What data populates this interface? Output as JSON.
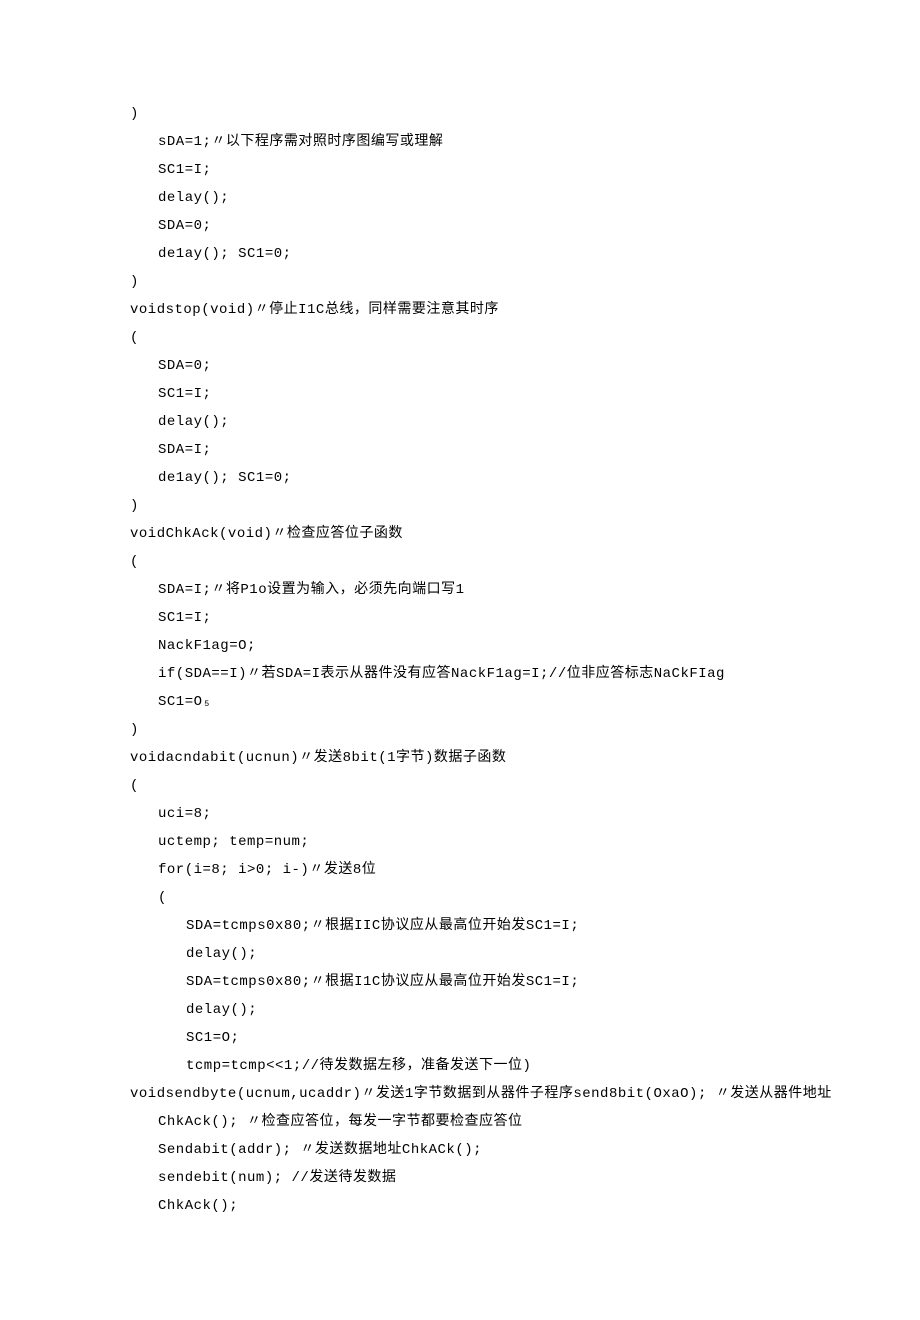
{
  "code_lines": [
    {
      "text": ")",
      "indent": 0
    },
    {
      "text": "sDA=1;〃以下程序需对照时序图编写或理解",
      "indent": 1
    },
    {
      "text": "SC1=I;",
      "indent": 1
    },
    {
      "text": "delay();",
      "indent": 1
    },
    {
      "text": "SDA=0;",
      "indent": 1
    },
    {
      "text": "de1ay(); SC1=0;",
      "indent": 1
    },
    {
      "text": ")",
      "indent": 0
    },
    {
      "text": "voidstop(void)〃停止I1C总线，同样需要注意其时序",
      "indent": 0
    },
    {
      "text": "(",
      "indent": 0
    },
    {
      "text": "SDA=0;",
      "indent": 1
    },
    {
      "text": "SC1=I;",
      "indent": 1
    },
    {
      "text": "delay();",
      "indent": 1
    },
    {
      "text": "SDA=I;",
      "indent": 1
    },
    {
      "text": "de1ay(); SC1=0;",
      "indent": 1
    },
    {
      "text": ")",
      "indent": 0
    },
    {
      "text": "voidChkAck(void)〃检查应答位子函数",
      "indent": 0
    },
    {
      "text": "(",
      "indent": 0
    },
    {
      "text": "SDA=I;〃将P1o设置为输入，必须先向端口写1",
      "indent": 1
    },
    {
      "text": "SC1=I;",
      "indent": 1
    },
    {
      "text": "NackF1ag=O;",
      "indent": 1
    },
    {
      "text": "if(SDA==I)〃若SDA=I表示从器件没有应答NackF1ag=I;//位非应答标志NaCkFIag",
      "indent": 1
    },
    {
      "text": "SC1=O₅",
      "indent": 1
    },
    {
      "text": ")",
      "indent": 0
    },
    {
      "text": "voidacndabit(ucnun)〃发送8bit(1字节)数据子函数",
      "indent": 0
    },
    {
      "text": "(",
      "indent": 0
    },
    {
      "text": "uci=8;",
      "indent": 1
    },
    {
      "text": "uctemp; temp=num;",
      "indent": 1
    },
    {
      "text": "for(i=8; i>0; i-)〃发送8位",
      "indent": 1
    },
    {
      "text": "(",
      "indent": 1
    },
    {
      "text": "SDA=tcmps0x80;〃根据IIC协议应从最高位开始发SC1=I;",
      "indent": 2
    },
    {
      "text": "delay();",
      "indent": 2
    },
    {
      "text": "SDA=tcmps0x80;〃根据I1C协议应从最高位开始发SC1=I;",
      "indent": 2
    },
    {
      "text": "delay();",
      "indent": 2
    },
    {
      "text": "SC1=O;",
      "indent": 2
    },
    {
      "text": "tcmp=tcmp<<1;//待发数据左移，准备发送下一位)",
      "indent": 2
    },
    {
      "text": "voidsendbyte(ucnum,ucaddr)〃发送1字节数据到从器件子程序send8bit(OxaO); 〃发送从器件地址",
      "indent": 0
    },
    {
      "text": "ChkAck(); 〃检查应答位，每发一字节都要检查应答位",
      "indent": 1
    },
    {
      "text": "Sendabit(addr); 〃发送数据地址ChkACk();",
      "indent": 1
    },
    {
      "text": "sendebit(num); //发送待发数据",
      "indent": 1
    },
    {
      "text": "ChkAck();",
      "indent": 1
    }
  ]
}
